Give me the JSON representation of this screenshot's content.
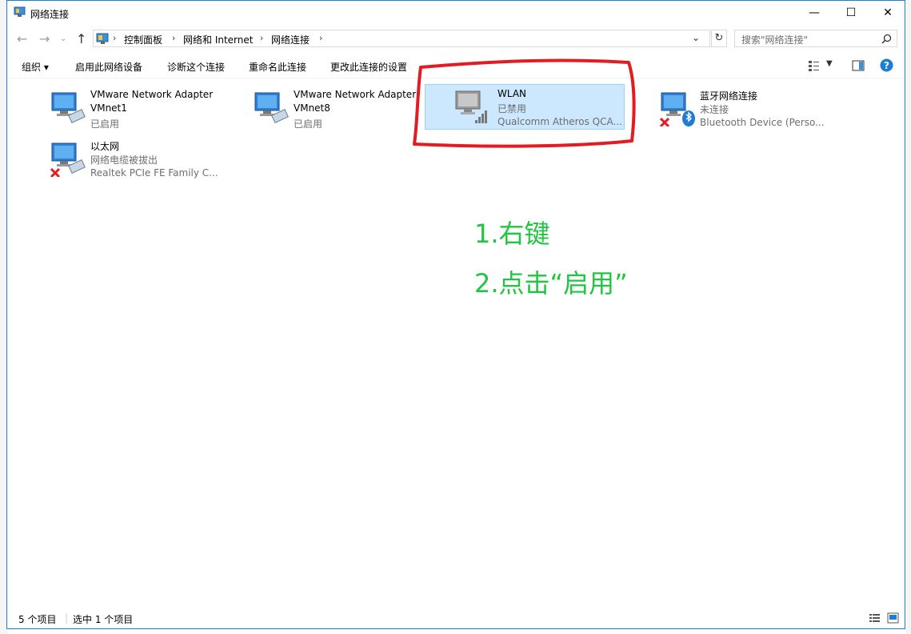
{
  "window": {
    "title": "网络连接"
  },
  "breadcrumb": [
    "控制面板",
    "网络和 Internet",
    "网络连接"
  ],
  "search": {
    "placeholder": "搜索\"网络连接\""
  },
  "toolbar": {
    "organize": "组织 ▾",
    "enable_device": "启用此网络设备",
    "diagnose": "诊断这个连接",
    "rename": "重命名此连接",
    "change_settings": "更改此连接的设置"
  },
  "items": [
    {
      "line1": "VMware Network Adapter",
      "line2": "VMnet1",
      "line3": "已启用",
      "icon": "network-adapter-icon"
    },
    {
      "line1": "VMware Network Adapter",
      "line2": "VMnet8",
      "line3": "已启用",
      "icon": "network-adapter-icon"
    },
    {
      "line1": "WLAN",
      "line2": "已禁用",
      "line3": "Qualcomm Atheros QCA...",
      "icon": "wlan-adapter-icon",
      "selected": true
    },
    {
      "line1": "蓝牙网络连接",
      "line2": "未连接",
      "line3": "Bluetooth Device (Perso...",
      "icon": "bluetooth-adapter-icon"
    },
    {
      "line1": "以太网",
      "line2": "网络电缆被拔出",
      "line3": "Realtek PCIe FE Family C...",
      "icon": "ethernet-adapter-icon"
    }
  ],
  "annotation": {
    "step1": "1.右键",
    "step2": "2.点击“启用”"
  },
  "status": {
    "count": "5 个项目",
    "selected": "选中 1 个项目"
  },
  "colors": {
    "accent": "#1c7cd6",
    "selection": "#cce8ff",
    "annotation": "#22c542",
    "highlight_circle": "#e31b23"
  }
}
